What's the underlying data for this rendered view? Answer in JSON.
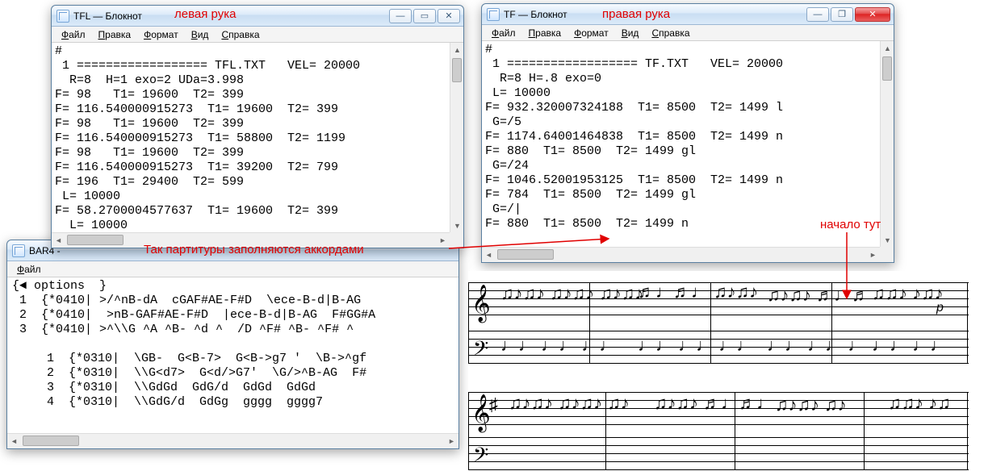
{
  "annotations": {
    "left_hand": "левая рука",
    "right_hand": "правая рука",
    "score_chords": "Так партитуры заполняются аккордами",
    "start_here": "начало тут"
  },
  "tfl_window": {
    "title": "TFL — Блокнот",
    "menu": [
      "Файл",
      "Правка",
      "Формат",
      "Вид",
      "Справка"
    ],
    "content": "#\n 1 ================== TFL.TXT   VEL= 20000\n  R=8  H=1 exo=2 UDa=3.998\nF= 98   T1= 19600  T2= 399\nF= 116.540000915273  T1= 19600  T2= 399\nF= 98   T1= 19600  T2= 399\nF= 116.540000915273  T1= 58800  T2= 1199\nF= 98   T1= 19600  T2= 399\nF= 116.540000915273  T1= 39200  T2= 799\nF= 196  T1= 29400  T2= 599\n L= 10000\nF= 58.2700004577637  T1= 19600  T2= 399\n  L= 10000"
  },
  "tf_window": {
    "title": "TF — Блокнот",
    "menu": [
      "Файл",
      "Правка",
      "Формат",
      "Вид",
      "Справка"
    ],
    "content": "#\n 1 ================== TF.TXT   VEL= 20000\n  R=8 H=.8 exo=0\n L= 10000\nF= 932.320007324188  T1= 8500  T2= 1499 l\n G=/5\nF= 1174.64001464838  T1= 8500  T2= 1499 n\nF= 880  T1= 8500  T2= 1499 gl\n G=/24\nF= 1046.52001953125  T1= 8500  T2= 1499 n\nF= 784  T1= 8500  T2= 1499 gl\n G=/|\nF= 880  T1= 8500  T2= 1499 n"
  },
  "bar4_window": {
    "title": "BAR4 -",
    "menu": [
      "Файл"
    ],
    "content1": "{◄ options  }\n 1  {*0410| >/^nB-dA  cGAF#AE-F#D  \\ece-B-d|B-AG\n 2  {*0410|  >nB-GAF#AE-F#D  |ece-B-d|B-AG  F#GG#A\n 3  {*0410| >^\\\\G ^A ^B- ^d ^  /D ^F# ^B- ^F# ^",
    "content2": " 1  {*0310|  \\GB-  G<B-7>  G<B->g7 '  \\B->^gf\n 2  {*0310|  \\\\G<d7>  G<d/>G7'  \\G/>^B-AG  F#\n 3  {*0310|  \\\\GdGd  GdG/d  GdGd  GdGd\n 4  {*0310|  \\\\GdG/d  GdGg  gggg  gggg7"
  },
  "btn": {
    "min": "—",
    "max": "▭",
    "restore": "❐",
    "close": "✕"
  }
}
